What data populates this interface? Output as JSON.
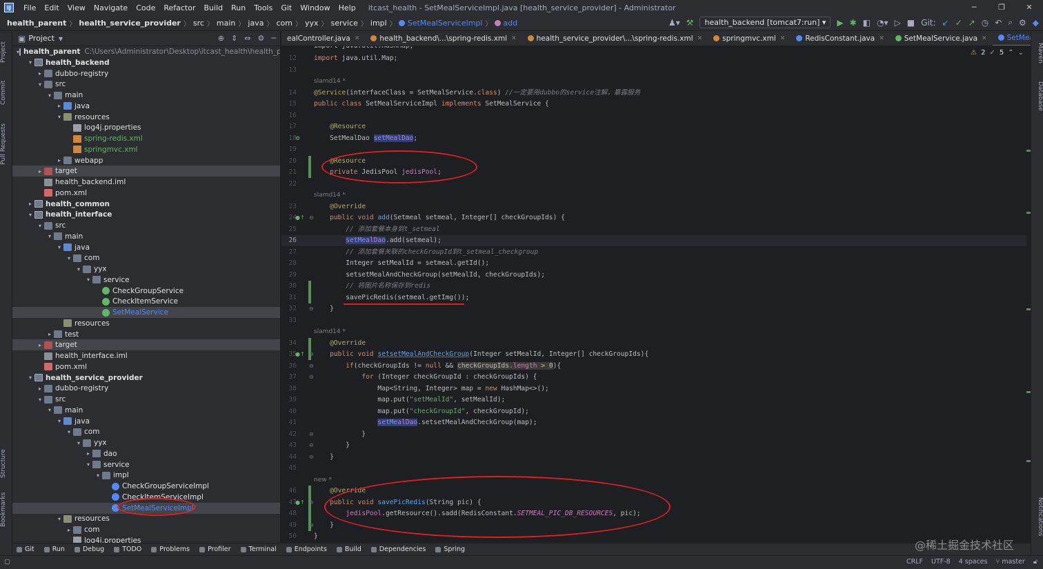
{
  "menubar": {
    "logo": "IJ",
    "items": [
      "File",
      "Edit",
      "View",
      "Navigate",
      "Code",
      "Refactor",
      "Build",
      "Run",
      "Tools",
      "Git",
      "Window",
      "Help"
    ],
    "title": "itcast_health - SetMealServiceImpl.java [health_service_provider] - Administrator"
  },
  "navbar": {
    "crumbs": [
      "health_parent",
      "health_service_provider",
      "src",
      "main",
      "java",
      "com",
      "yyx",
      "service",
      "impl",
      "SetMealServiceImpl",
      "add"
    ],
    "run_config": "health_backend [tomcat7:run]",
    "git_label": "Git:"
  },
  "project_panel": {
    "title": "Project"
  },
  "tree": [
    {
      "label": "health_parent",
      "path": "C:\\Users\\Administrator\\Desktop\\itcast_health\\health_parent",
      "depth": 0,
      "arrow": "v",
      "icon": "mod",
      "style": "b"
    },
    {
      "label": "health_backend",
      "depth": 1,
      "arrow": "v",
      "icon": "mod",
      "style": "b"
    },
    {
      "label": "dubbo-registry",
      "depth": 2,
      "arrow": ">",
      "icon": "folder"
    },
    {
      "label": "src",
      "depth": 2,
      "arrow": "v",
      "icon": "folder"
    },
    {
      "label": "main",
      "depth": 3,
      "arrow": "v",
      "icon": "folder"
    },
    {
      "label": "java",
      "depth": 4,
      "arrow": ">",
      "icon": "srcf"
    },
    {
      "label": "resources",
      "depth": 4,
      "arrow": "v",
      "icon": "resf"
    },
    {
      "label": "log4j.properties",
      "depth": 5,
      "arrow": "",
      "icon": "prop"
    },
    {
      "label": "spring-redis.xml",
      "depth": 5,
      "arrow": "",
      "icon": "xml",
      "style": "gr"
    },
    {
      "label": "springmvc.xml",
      "depth": 5,
      "arrow": "",
      "icon": "xml",
      "style": "gr"
    },
    {
      "label": "webapp",
      "depth": 4,
      "arrow": ">",
      "icon": "folder"
    },
    {
      "label": "target",
      "depth": 2,
      "arrow": ">",
      "icon": "excl",
      "sel": true
    },
    {
      "label": "health_backend.iml",
      "depth": 2,
      "arrow": "",
      "icon": "iml"
    },
    {
      "label": "pom.xml",
      "depth": 2,
      "arrow": "",
      "icon": "pom"
    },
    {
      "label": "health_common",
      "depth": 1,
      "arrow": ">",
      "icon": "mod",
      "style": "b"
    },
    {
      "label": "health_interface",
      "depth": 1,
      "arrow": "v",
      "icon": "mod",
      "style": "b"
    },
    {
      "label": "src",
      "depth": 2,
      "arrow": "v",
      "icon": "folder"
    },
    {
      "label": "main",
      "depth": 3,
      "arrow": "v",
      "icon": "folder"
    },
    {
      "label": "java",
      "depth": 4,
      "arrow": "v",
      "icon": "srcf"
    },
    {
      "label": "com",
      "depth": 5,
      "arrow": "v",
      "icon": "folder"
    },
    {
      "label": "yyx",
      "depth": 6,
      "arrow": "v",
      "icon": "folder"
    },
    {
      "label": "service",
      "depth": 7,
      "arrow": "v",
      "icon": "folder"
    },
    {
      "label": "CheckGroupService",
      "depth": 8,
      "arrow": "",
      "icon": "intf"
    },
    {
      "label": "CheckItemService",
      "depth": 8,
      "arrow": "",
      "icon": "intf"
    },
    {
      "label": "SetMealService",
      "depth": 8,
      "arrow": "",
      "icon": "intf",
      "style": "bl",
      "sel": true
    },
    {
      "label": "resources",
      "depth": 4,
      "arrow": "",
      "icon": "resf"
    },
    {
      "label": "test",
      "depth": 3,
      "arrow": ">",
      "icon": "folder"
    },
    {
      "label": "target",
      "depth": 2,
      "arrow": ">",
      "icon": "excl",
      "sel": true
    },
    {
      "label": "health_interface.iml",
      "depth": 2,
      "arrow": "",
      "icon": "iml"
    },
    {
      "label": "pom.xml",
      "depth": 2,
      "arrow": "",
      "icon": "pom"
    },
    {
      "label": "health_service_provider",
      "depth": 1,
      "arrow": "v",
      "icon": "mod",
      "style": "b"
    },
    {
      "label": "dubbo-registry",
      "depth": 2,
      "arrow": ">",
      "icon": "folder"
    },
    {
      "label": "src",
      "depth": 2,
      "arrow": "v",
      "icon": "folder"
    },
    {
      "label": "main",
      "depth": 3,
      "arrow": "v",
      "icon": "folder"
    },
    {
      "label": "java",
      "depth": 4,
      "arrow": "v",
      "icon": "srcf"
    },
    {
      "label": "com",
      "depth": 5,
      "arrow": "v",
      "icon": "folder"
    },
    {
      "label": "yyx",
      "depth": 6,
      "arrow": "v",
      "icon": "folder"
    },
    {
      "label": "dao",
      "depth": 7,
      "arrow": ">",
      "icon": "folder"
    },
    {
      "label": "service",
      "depth": 7,
      "arrow": "v",
      "icon": "folder"
    },
    {
      "label": "impl",
      "depth": 8,
      "arrow": "v",
      "icon": "folder"
    },
    {
      "label": "CheckGroupServiceImpl",
      "depth": 9,
      "arrow": "",
      "icon": "cls"
    },
    {
      "label": "CheckItemServiceImpl",
      "depth": 9,
      "arrow": "",
      "icon": "cls"
    },
    {
      "label": "SetMealServiceImpl",
      "depth": 9,
      "arrow": "",
      "icon": "cls",
      "style": "bl",
      "sel": true
    },
    {
      "label": "resources",
      "depth": 4,
      "arrow": "v",
      "icon": "resf"
    },
    {
      "label": "com",
      "depth": 5,
      "arrow": ">",
      "icon": "folder"
    },
    {
      "label": "log4j.properties",
      "depth": 5,
      "arrow": "",
      "icon": "prop"
    }
  ],
  "tabs": [
    {
      "label": "ealController.java",
      "color": "#548af7"
    },
    {
      "label": "health_backend\\...\\spring-redis.xml",
      "color": "#d08738"
    },
    {
      "label": "health_service_provider\\...\\spring-redis.xml",
      "color": "#d08738"
    },
    {
      "label": "springmvc.xml",
      "color": "#d08738"
    },
    {
      "label": "RedisConstant.java",
      "color": "#548af7"
    },
    {
      "label": "SetMealService.java",
      "color": "#5fb865"
    },
    {
      "label": "SetMealServiceImpl.java",
      "color": "#548af7",
      "active": true
    }
  ],
  "editor": {
    "warnings": "2",
    "checks": "5",
    "current_line": "26",
    "authors": [
      {
        "text": "slamd14 *",
        "before": 14
      },
      {
        "text": "slamd14 *",
        "before": 23
      },
      {
        "text": "slamd14 *",
        "before": 34
      },
      {
        "text": "new *",
        "before": 46
      }
    ],
    "top_fragment": "import java.util.HashMap;",
    "lines": [
      {
        "n": "12",
        "html": "<span class=\"kw\">import</span> java.util.Map;"
      },
      {
        "n": "13",
        "html": ""
      },
      {
        "n": "14",
        "html": "<span class=\"an\">@Service</span>(interfaceClass = SetMealService.<span class=\"kw\">class</span>) <span class=\"cm\">//一定要用dubbo的service注解，暴露服务</span>"
      },
      {
        "n": "15",
        "html": "<span class=\"kw\">public class</span> SetMealServiceImpl <span class=\"kw\">implements</span> SetMealService {"
      },
      {
        "n": "16",
        "html": ""
      },
      {
        "n": "17",
        "html": "    <span class=\"an\">@Resource</span>"
      },
      {
        "n": "18",
        "html": "    SetMealDao <span class=\"fld hl\">setMealDao</span>;"
      },
      {
        "n": "19",
        "html": ""
      },
      {
        "n": "20",
        "html": "    <span class=\"an\">@Resource</span>"
      },
      {
        "n": "21",
        "html": "    <span class=\"kw\">private</span> JedisPool <span class=\"fld\">jedisPool</span>;"
      },
      {
        "n": "22",
        "html": ""
      },
      {
        "n": "23",
        "html": "    <span class=\"an\">@Override</span>"
      },
      {
        "n": "24",
        "html": "    <span class=\"kw\">public void</span> <span class=\"fn\">add</span>(Setmeal setmeal, Integer[] checkGroupIds) {"
      },
      {
        "n": "25",
        "html": "        <span class=\"cm\">// 添加套餐本身到t_setmeal</span>"
      },
      {
        "n": "26",
        "html": "        <span class=\"fld hl\">setMealDao</span>.add(setmeal);"
      },
      {
        "n": "27",
        "html": "        <span class=\"cm\">// 添加套餐关联的checkGroupId到t_setmeal_checkgroup</span>"
      },
      {
        "n": "28",
        "html": "        Integer setMealId = setmeal.getId();"
      },
      {
        "n": "29",
        "html": "        setsetMealAndCheckGroup(setMealId, checkGroupIds);"
      },
      {
        "n": "30",
        "html": "        <span class=\"cm\">// 将图片名称保存到redis</span>"
      },
      {
        "n": "31",
        "html": "        savePicRedis(setmeal.getImg());"
      },
      {
        "n": "32",
        "html": "    }"
      },
      {
        "n": "33",
        "html": ""
      },
      {
        "n": "34",
        "html": "    <span class=\"an\">@Override</span>"
      },
      {
        "n": "35",
        "html": "    <span class=\"kw\">public void</span> <span class=\"fn ul\">setsetMealAndCheckGroup</span>(Integer setMealId, Integer[] checkGroupIds){"
      },
      {
        "n": "36",
        "html": "        <span class=\"kw\">if</span>(checkGroupIds != <span class=\"kw\">null</span> &amp;&amp; <span class=\"hl2\">checkGroupIds.<span class=\"fld\">length</span> &gt; 0</span>){"
      },
      {
        "n": "37",
        "html": "            <span class=\"kw\">for</span> (Integer checkGroupId : checkGroupIds) {"
      },
      {
        "n": "38",
        "html": "                Map&lt;String, Integer&gt; map = <span class=\"kw\">new</span> HashMap&lt;&gt;();"
      },
      {
        "n": "39",
        "html": "                map.put(<span class=\"st\">\"setMealId\"</span>, setMealId);"
      },
      {
        "n": "40",
        "html": "                map.put(<span class=\"st\">\"checkGroupId\"</span>, checkGroupId);"
      },
      {
        "n": "41",
        "html": "                <span class=\"fld hl\">setMealDao</span>.setsetMealAndCheckGroup(map);"
      },
      {
        "n": "42",
        "html": "            }"
      },
      {
        "n": "43",
        "html": "        }"
      },
      {
        "n": "44",
        "html": "    }"
      },
      {
        "n": "45",
        "html": ""
      },
      {
        "n": "46",
        "html": "    <span class=\"an\">@Override</span>"
      },
      {
        "n": "47",
        "html": "    <span class=\"kw\">public void</span> <span class=\"fn\">savePicRedis</span>(String pic) {"
      },
      {
        "n": "48",
        "html": "        <span class=\"fld\">jedisPool</span>.getResource().sadd(RedisConstant.<span class=\"cst\">SETMEAL_PIC_DB_RESOURCES</span>, pic);"
      },
      {
        "n": "49",
        "html": "    }"
      },
      {
        "n": "50",
        "html": "}"
      }
    ]
  },
  "left_strip": [
    "Project",
    "Commit",
    "Pull Requests",
    "Structure",
    "Bookmarks"
  ],
  "right_strip": [
    "Maven",
    "Database",
    "Notifications"
  ],
  "bottom_tools": [
    "Git",
    "Run",
    "Debug",
    "TODO",
    "Problems",
    "Profiler",
    "Terminal",
    "Endpoints",
    "Build",
    "Dependencies",
    "Spring"
  ],
  "status": {
    "line_ending": "CRLF",
    "encoding": "UTF-8",
    "indent": "4 spaces",
    "branch": "master"
  },
  "watermark": "@稀土掘金技术社区",
  "colors": {
    "accent": "#3574f0",
    "annotation_red": "#e02020",
    "added_marker": "#549159"
  }
}
